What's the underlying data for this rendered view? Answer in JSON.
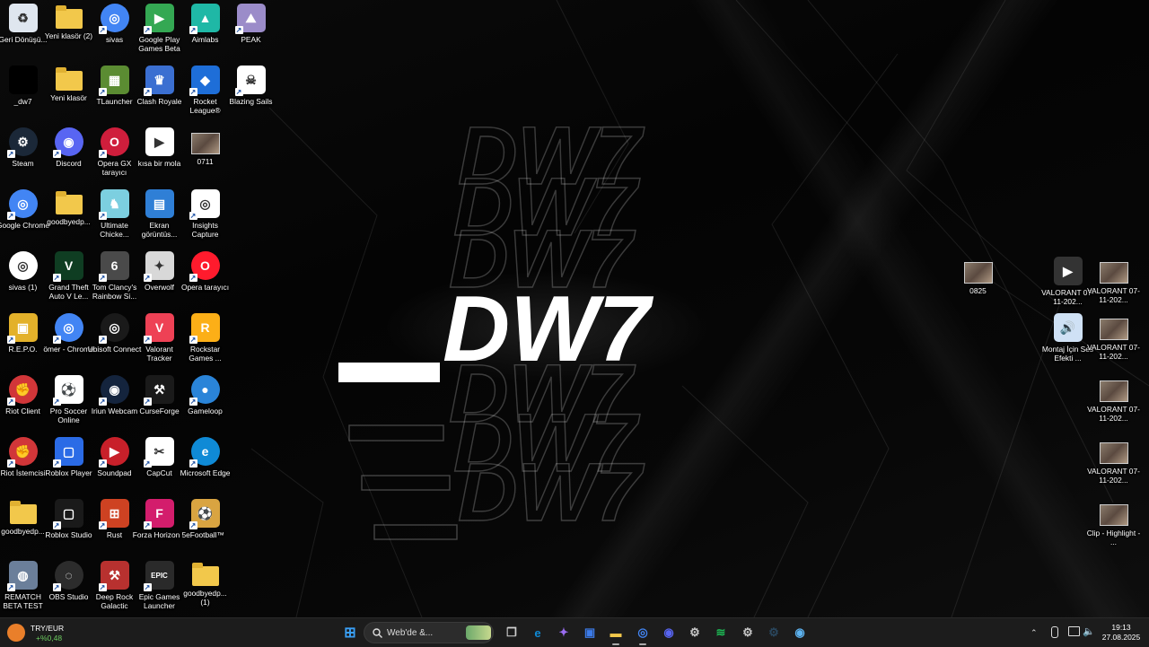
{
  "desktop": {
    "wallpaper": {
      "logo_text": "DW7",
      "logo_prefix": "_"
    },
    "icons": [
      {
        "id": "recycle",
        "label": "Geri Dönüşü...",
        "icon": "recycle-bin-icon",
        "color": "#dfe6ef"
      },
      {
        "id": "folder2",
        "label": "Yeni klasör (2)",
        "icon": "folder-icon",
        "color": "#f2c84b"
      },
      {
        "id": "sivas",
        "label": "sivas",
        "icon": "chrome-icon",
        "color": "#4285f4"
      },
      {
        "id": "gpgames",
        "label": "Google Play Games Beta",
        "icon": "google-play-games-icon",
        "color": "#34a853"
      },
      {
        "id": "aimlabs",
        "label": "Aimlabs",
        "icon": "aimlabs-icon",
        "color": "#1fb8a6"
      },
      {
        "id": "peak",
        "label": "PEAK",
        "icon": "peak-icon",
        "color": "#9b8cc9"
      },
      {
        "id": "dw7",
        "label": "_dw7",
        "icon": "dw7-file-icon",
        "color": "#000000"
      },
      {
        "id": "folder",
        "label": "Yeni klasör",
        "icon": "folder-icon",
        "color": "#f2c84b"
      },
      {
        "id": "tlauncher",
        "label": "TLauncher",
        "icon": "tlauncher-icon",
        "color": "#5b8c32"
      },
      {
        "id": "clashroyale",
        "label": "Clash Royale",
        "icon": "clash-royale-icon",
        "color": "#3b6fd1"
      },
      {
        "id": "rocketleague",
        "label": "Rocket League®",
        "icon": "rocket-league-icon",
        "color": "#1e6ed8"
      },
      {
        "id": "blazingsails",
        "label": "Blazing Sails",
        "icon": "skull-icon",
        "color": "#ffffff"
      },
      {
        "id": "steam",
        "label": "Steam",
        "icon": "steam-icon",
        "color": "#1b2838"
      },
      {
        "id": "discord",
        "label": "Discord",
        "icon": "discord-icon",
        "color": "#5865f2"
      },
      {
        "id": "operagx",
        "label": "Opera GX tarayıcı",
        "icon": "opera-gx-icon",
        "color": "#cf1e3c"
      },
      {
        "id": "kisabirmola",
        "label": "kısa bir mola",
        "icon": "video-file-icon",
        "color": "#ffffff"
      },
      {
        "id": "v0711",
        "label": "0711",
        "icon": "video-thumbnail-icon",
        "color": "#6b5a4e"
      },
      {
        "id": "chrome",
        "label": "Google Chrome",
        "icon": "chrome-icon",
        "color": "#4285f4"
      },
      {
        "id": "goodbyedp",
        "label": "goodbyedp...",
        "icon": "zip-folder-icon",
        "color": "#f2c84b"
      },
      {
        "id": "ultimatechicken",
        "label": "Ultimate Chicke...",
        "icon": "ultimate-chicken-horse-icon",
        "color": "#7ccfe0"
      },
      {
        "id": "ekrangoruntusu",
        "label": "Ekran görüntüs...",
        "icon": "image-file-icon",
        "color": "#2f7fd6"
      },
      {
        "id": "insights",
        "label": "Insights Capture",
        "icon": "insights-capture-icon",
        "color": "#ffffff"
      },
      {
        "id": "sivas1",
        "label": "sivas (1)",
        "icon": "chrome-html-file-icon",
        "color": "#ffffff"
      },
      {
        "id": "gta",
        "label": "Grand Theft Auto V Le...",
        "icon": "gta-v-icon",
        "color": "#0f3d22"
      },
      {
        "id": "r6",
        "label": "Tom Clancy's Rainbow Si...",
        "icon": "rainbow-six-icon",
        "color": "#4a4a4a"
      },
      {
        "id": "overwolf",
        "label": "Overwolf",
        "icon": "overwolf-icon",
        "color": "#d8d8d8"
      },
      {
        "id": "opera",
        "label": "Opera tarayıcı",
        "icon": "opera-icon",
        "color": "#ff1b2d"
      },
      {
        "id": "repo",
        "label": "R.E.P.O.",
        "icon": "repo-icon",
        "color": "#e3b12a"
      },
      {
        "id": "omerchrome",
        "label": "ömer - Chrome",
        "icon": "chrome-profile-icon",
        "color": "#4285f4"
      },
      {
        "id": "ubisoft",
        "label": "Ubisoft Connect",
        "icon": "ubisoft-icon",
        "color": "#1a1a1a"
      },
      {
        "id": "valoranttracker",
        "label": "Valorant Tracker",
        "icon": "valorant-tracker-icon",
        "color": "#ee4155"
      },
      {
        "id": "rockstar",
        "label": "Rockstar Games ...",
        "icon": "rockstar-icon",
        "color": "#fcaf17"
      },
      {
        "id": "riotclient",
        "label": "Riot Client",
        "icon": "riot-client-icon",
        "color": "#d13639"
      },
      {
        "id": "prosoccer",
        "label": "Pro Soccer Online",
        "icon": "soccer-ball-icon",
        "color": "#ffffff"
      },
      {
        "id": "iriun",
        "label": "Iriun Webcam",
        "icon": "iriun-webcam-icon",
        "color": "#14243d"
      },
      {
        "id": "curseforge",
        "label": "CurseForge",
        "icon": "curseforge-icon",
        "color": "#1a1a1a"
      },
      {
        "id": "gameloop",
        "label": "Gameloop",
        "icon": "gameloop-icon",
        "color": "#2a84d8"
      },
      {
        "id": "riotistemcisi",
        "label": "Riot İstemcisi",
        "icon": "riot-client-icon",
        "color": "#d13639"
      },
      {
        "id": "roblox",
        "label": "Roblox Player",
        "icon": "roblox-icon",
        "color": "#2b6be6"
      },
      {
        "id": "soundpad",
        "label": "Soundpad",
        "icon": "soundpad-icon",
        "color": "#c8202a"
      },
      {
        "id": "capcut",
        "label": "CapCut",
        "icon": "capcut-icon",
        "color": "#ffffff"
      },
      {
        "id": "edge",
        "label": "Microsoft Edge",
        "icon": "edge-icon",
        "color": "#0f8ad6"
      },
      {
        "id": "goodbyedp2",
        "label": "goodbyedp...",
        "icon": "folder-icon",
        "color": "#f2c84b"
      },
      {
        "id": "robloxstudio",
        "label": "Roblox Studio",
        "icon": "roblox-studio-icon",
        "color": "#1a1a1a"
      },
      {
        "id": "rust",
        "label": "Rust",
        "icon": "rust-icon",
        "color": "#ce4222"
      },
      {
        "id": "forza",
        "label": "Forza Horizon 5",
        "icon": "forza-icon",
        "color": "#d31d6c"
      },
      {
        "id": "efootball",
        "label": "eFootball™",
        "icon": "efootball-icon",
        "color": "#d9a441"
      },
      {
        "id": "rematch",
        "label": "REMATCH BETA TEST",
        "icon": "rematch-icon",
        "color": "#6b7f9a"
      },
      {
        "id": "obs",
        "label": "OBS Studio",
        "icon": "obs-icon",
        "color": "#2c2c2c"
      },
      {
        "id": "deeprock",
        "label": "Deep Rock Galactic",
        "icon": "deep-rock-icon",
        "color": "#b8312f"
      },
      {
        "id": "epic",
        "label": "Epic Games Launcher",
        "icon": "epic-games-icon",
        "color": "#2a2a2a"
      },
      {
        "id": "goodbyedp1",
        "label": "goodbyedp... (1)",
        "icon": "folder-icon",
        "color": "#f2c84b"
      },
      {
        "id": "v0825",
        "label": "0825",
        "icon": "video-thumbnail-icon",
        "color": "#6b5a4e"
      },
      {
        "id": "valorant1",
        "label": "VALORANT 07-11-202...",
        "icon": "video-file-icon",
        "color": "#333333"
      },
      {
        "id": "valorant2",
        "label": "VALORANT 07-11-202...",
        "icon": "video-thumbnail-icon",
        "color": "#7d6a5a"
      },
      {
        "id": "montaj",
        "label": "Montaj İçin Ses Efekti ...",
        "icon": "audio-file-icon",
        "color": "#cfe1f5"
      },
      {
        "id": "valorant3",
        "label": "VALORANT 07-11-202...",
        "icon": "video-thumbnail-icon",
        "color": "#7d6a5a"
      },
      {
        "id": "valorant4",
        "label": "VALORANT 07-11-202...",
        "icon": "video-thumbnail-icon",
        "color": "#7d6a5a"
      },
      {
        "id": "valorant5",
        "label": "VALORANT 07-11-202...",
        "icon": "video-thumbnail-icon",
        "color": "#7d6a5a"
      },
      {
        "id": "clip",
        "label": "Clip - Highlight - ...",
        "icon": "video-thumbnail-icon",
        "color": "#7d6a5a"
      }
    ]
  },
  "taskbar": {
    "weather": {
      "name": "TRY/EUR",
      "value": "+%0,48",
      "icon": "currency-widget-icon"
    },
    "search_placeholder": "Web'de &...",
    "pinned": [
      {
        "id": "start",
        "icon": "windows-start-icon",
        "color": "#3a9ff5"
      },
      {
        "id": "widgets",
        "icon": "widgets-icon",
        "color": "#4a9a6a"
      },
      {
        "id": "taskview",
        "icon": "task-view-icon",
        "color": "#cfcfcf"
      },
      {
        "id": "edge",
        "icon": "edge-icon",
        "color": "#0f8ad6"
      },
      {
        "id": "copilot",
        "icon": "copilot-icon",
        "color": "#9a6cf0"
      },
      {
        "id": "store",
        "icon": "store-icon",
        "color": "#3c7be8"
      },
      {
        "id": "explorer",
        "icon": "file-explorer-icon",
        "color": "#f2c84b"
      },
      {
        "id": "chrome",
        "icon": "chrome-icon",
        "color": "#4285f4"
      },
      {
        "id": "discord",
        "icon": "discord-icon",
        "color": "#5865f2"
      },
      {
        "id": "settings",
        "icon": "gear-icon",
        "color": "#c8c8c8"
      },
      {
        "id": "spotify",
        "icon": "spotify-icon",
        "color": "#1db954"
      },
      {
        "id": "steamhelper",
        "icon": "steam-helper-icon",
        "color": "#c8c8c8"
      },
      {
        "id": "steam",
        "icon": "steam-icon",
        "color": "#2a475e"
      },
      {
        "id": "app",
        "icon": "app-icon",
        "color": "#5db3f0"
      }
    ],
    "tray": {
      "clock_time": "19:13",
      "clock_date": "27.08.2025"
    }
  }
}
